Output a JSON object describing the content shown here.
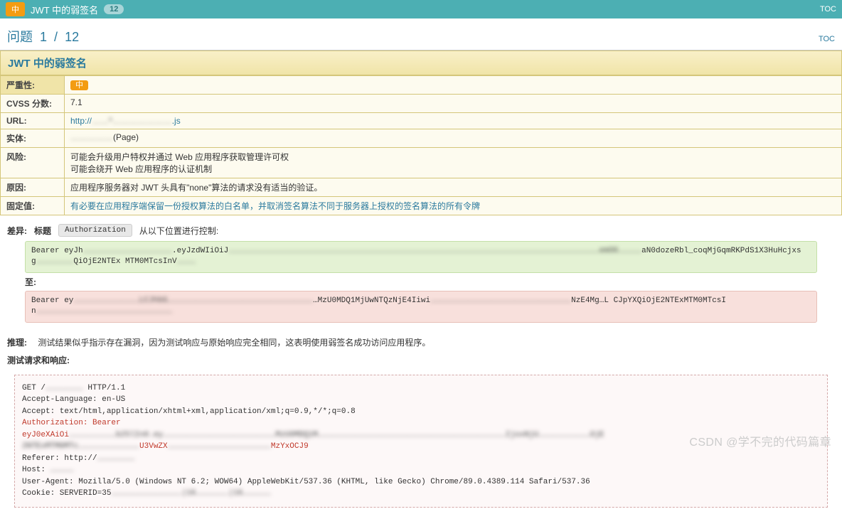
{
  "top": {
    "badge": "中",
    "title": "JWT 中的弱签名",
    "count": "12",
    "toc": "TOC"
  },
  "section": {
    "question_label": "问题",
    "question_num": "1",
    "question_sep": "/",
    "question_total": "12",
    "toc": "TOC"
  },
  "issue_title": "JWT 中的弱签名",
  "details": {
    "severity_label": "严重性:",
    "severity_value": "中",
    "cvss_label": "CVSS 分数:",
    "cvss_value": "7.1",
    "url_label": "URL:",
    "url_prefix": "http://",
    "url_blur": "……*…………………",
    "url_suffix": ".js",
    "entity_label": "实体:",
    "entity_blur": "……………",
    "entity_suffix": "(Page)",
    "risk_label": "风险:",
    "risk_line1": "可能会升级用户特权并通过 Web 应用程序获取管理许可权",
    "risk_line2": "可能会绕开 Web 应用程序的认证机制",
    "cause_label": "原因:",
    "cause_value": "应用程序服务器对 JWT 头具有\"none\"算法的请求没有适当的验证。",
    "fix_label": "固定值:",
    "fix_value": "有必要在应用程序端保留一份授权算法的白名单，并取消签名算法不同于服务器上授权的签名算法的所有令牌"
  },
  "diff": {
    "label": "差异:",
    "header_label": "标题",
    "header_value": "Authorization",
    "control_text": "从以下位置进行控制:",
    "token1_prefix": "Bearer eyJh",
    "token1_blur": "…………………………………………………",
    "token1_mid": ".eyJzdWIiOiJ",
    "token1_blur2": "…………………………………………………………………………………………………………………………………………………………………………………………………………………emO0……………",
    "token1_mid2": "aN0dozeRbl_coqMjGqmRKPdS1X3HuHcjxsg",
    "token1_suffix": "QiOjE2NTEx\nMTM0MTcsInV",
    "to_label": "至:",
    "token2_prefix": "Bearer ey",
    "token2_blur": "……………………………………LCJhbG…………………………………………………………………………………",
    "token2_mid": "…MzU0MDQ1MjUwNTQzNjE4Iiwi",
    "token2_blur2": "………………………………………………………………………………",
    "token2_suffix": "NzE4Mg…L\nCJpYXQiOjE2NTExMTM0MTcsIn",
    "token2_blur3": "……………………………………………………………………………"
  },
  "inference": {
    "label": "推理:",
    "text": "测试结果似乎指示存在漏洞，因为测试响应与原始响应完全相同，这表明使用弱签名成功访问应用程序。"
  },
  "request": {
    "label": "测试请求和响应:",
    "line1": "GET /",
    "line1_blur": "……………………",
    "line1_suffix": " HTTP/1.1",
    "line2": "Accept-Language: en-US",
    "line3": "Accept: text/html,application/xhtml+xml,application/xml;q=0.9,*/*;q=0.8",
    "line4": "Authorization: Bearer",
    "line5_prefix": "eyJ0eXAiOi",
    "line5_blur": "…………………………b25lIn0.ey………………………………………………………………MzU0MDQ1M…………………………………………………………………………………………………………IjoxNjU……………………………OjE\n2NTExMTM0MTc…………………………………",
    "line5_mid": "U3VwZX",
    "line5_blur2": "…………………………………………………………",
    "line5_suffix": "MzYxOCJ9",
    "line6": "Referer: http://",
    "line6_blur": "……………………",
    "line7": "Host: ",
    "line7_blur": "……………",
    "line8": "User-Agent: Mozilla/5.0 (Windows NT 6.2; WOW64) AppleWebKit/537.36 (KHTML, like Gecko) Chrome/89.0.4389.114 Safari/537.36",
    "line9": "Cookie: SERVERID=35",
    "line9_blur": "………………………………………|16…………………|16………………"
  },
  "watermark": "CSDN @学不完的代码篇章"
}
